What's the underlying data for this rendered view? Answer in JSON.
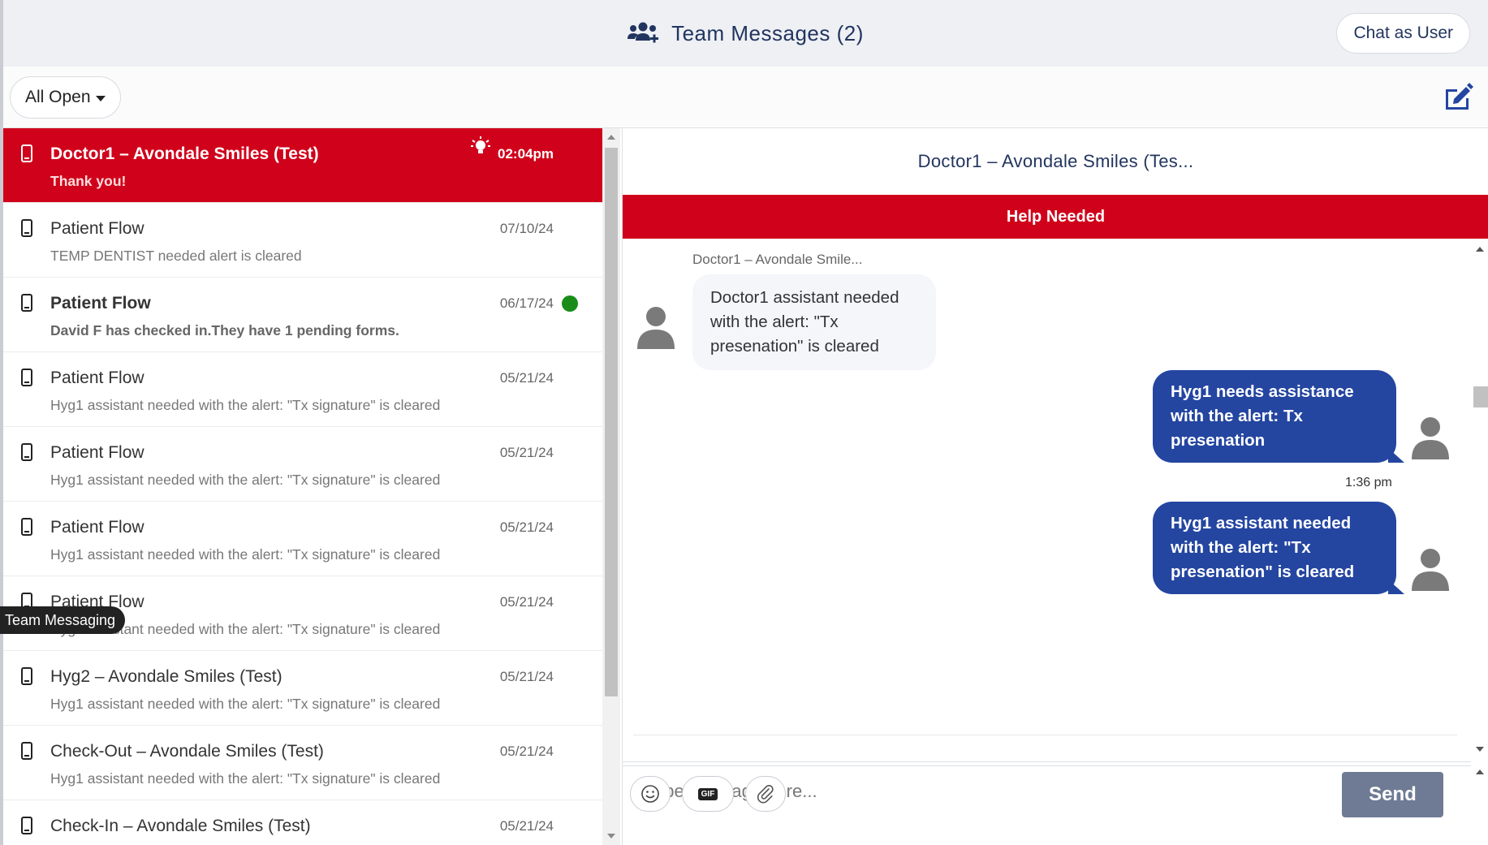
{
  "header": {
    "title": "Team Messages (2)",
    "chat_as_user_label": "Chat as User"
  },
  "filter": {
    "selected": "All Open"
  },
  "conversations": [
    {
      "name": "Doctor1 – Avondale Smiles (Test)",
      "preview": "Thank you!",
      "date": "02:04pm",
      "active": true,
      "unread": false
    },
    {
      "name": "Patient Flow",
      "preview": "TEMP DENTIST needed alert is cleared",
      "date": "07/10/24",
      "active": false,
      "unread": false
    },
    {
      "name": "Patient Flow",
      "preview": "David F has checked in.They have 1 pending forms.",
      "date": "06/17/24",
      "active": false,
      "unread": true
    },
    {
      "name": "Patient Flow",
      "preview": "Hyg1 assistant needed with the alert: \"Tx signature\" is cleared",
      "date": "05/21/24",
      "active": false,
      "unread": false
    },
    {
      "name": "Patient Flow",
      "preview": "Hyg1 assistant needed with the alert: \"Tx signature\" is cleared",
      "date": "05/21/24",
      "active": false,
      "unread": false
    },
    {
      "name": "Patient Flow",
      "preview": "Hyg1 assistant needed with the alert: \"Tx signature\" is cleared",
      "date": "05/21/24",
      "active": false,
      "unread": false
    },
    {
      "name": "Patient Flow",
      "preview": "Hyg1 assistant needed with the alert: \"Tx signature\" is cleared",
      "date": "05/21/24",
      "active": false,
      "unread": false
    },
    {
      "name": "Hyg2 – Avondale Smiles (Test)",
      "preview": "Hyg1 assistant needed with the alert: \"Tx signature\" is cleared",
      "date": "05/21/24",
      "active": false,
      "unread": false
    },
    {
      "name": "Check-Out – Avondale Smiles (Test)",
      "preview": "Hyg1 assistant needed with the alert: \"Tx signature\" is cleared",
      "date": "05/21/24",
      "active": false,
      "unread": false
    },
    {
      "name": "Check-In – Avondale Smiles (Test)",
      "preview": "Hyg1 assistant needed with the alert: \"Tx signature\" is cleared",
      "date": "05/21/24",
      "active": false,
      "unread": false
    }
  ],
  "tooltip": "Team Messaging",
  "chat": {
    "title": "Doctor1 – Avondale Smiles (Tes...",
    "banner": "Help Needed",
    "incoming": {
      "sender": "Doctor1 – Avondale Smile...",
      "text": "Doctor1 assistant needed with the alert: \"Tx presenation\" is cleared"
    },
    "outgoing": [
      {
        "text": "Hyg1 needs assistance with the alert: Tx presenation",
        "time": ""
      },
      {
        "text": "Hyg1 assistant needed with the alert: \"Tx presenation\" is cleared",
        "time": "1:36 pm"
      }
    ],
    "input_placeholder": "Type message here...",
    "gif_label": "GIF",
    "send_label": "Send"
  },
  "colors": {
    "active_red": "#d0021b",
    "outgoing_blue": "#2446a1",
    "navy_text": "#22355f",
    "unread_green": "#1a8c1a"
  },
  "icons": {
    "header": "team-icon",
    "compose": "compose-icon",
    "conversation": "phone-icon",
    "alert": "lightbulb-icon",
    "emoji": "emoji-icon",
    "attach": "paperclip-icon"
  }
}
